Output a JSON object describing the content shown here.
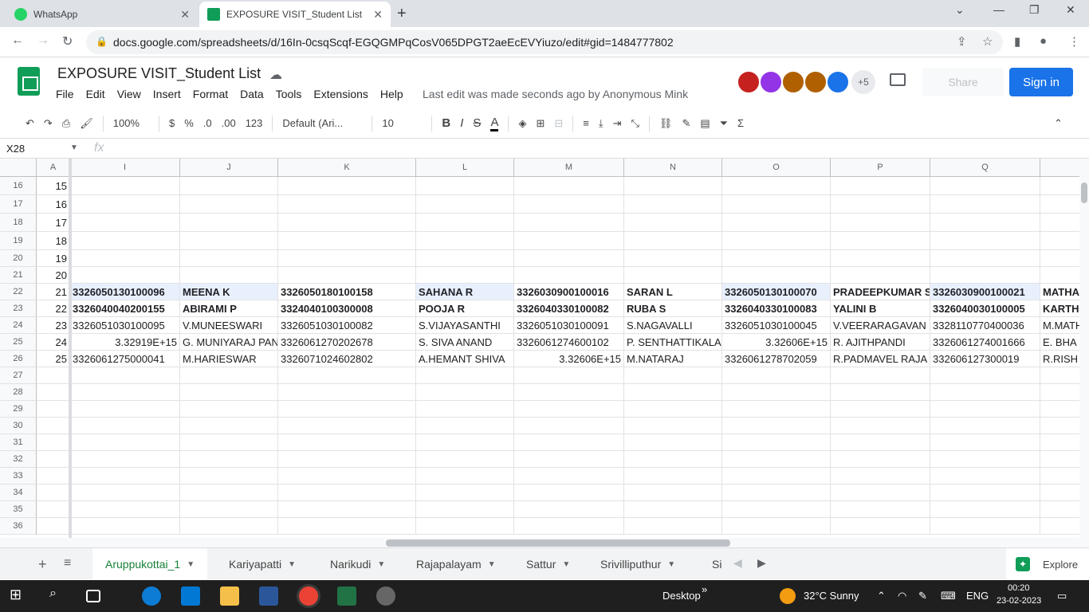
{
  "browser": {
    "tabs": [
      {
        "title": "WhatsApp",
        "favicon": "whatsapp-icon",
        "color": "#25d366"
      },
      {
        "title": "EXPOSURE VISIT_Student List - G",
        "favicon": "sheets-icon",
        "color": "#0f9d58"
      }
    ],
    "url": "docs.google.com/spreadsheets/d/16In-0csqScqf-EGQGMPqCosV065DPGT2aeEcEVYiuzo/edit#gid=1484777802"
  },
  "doc": {
    "title": "EXPOSURE VISIT_Student List",
    "menu": [
      "File",
      "Edit",
      "View",
      "Insert",
      "Format",
      "Data",
      "Tools",
      "Extensions",
      "Help"
    ],
    "last_edit": "Last edit was made seconds ago by Anonymous Mink",
    "more_collaborators": "+5",
    "share_label": "Share",
    "signin_label": "Sign in",
    "collaborator_colors": [
      "#c5221f",
      "#9334e6",
      "#b06000",
      "#b06000",
      "#1a73e8"
    ]
  },
  "toolbar": {
    "zoom": "100%",
    "currency": "$",
    "percent": "%",
    "decrease_decimal": ".0",
    "increase_decimal": ".00",
    "number_format": "123",
    "font": "Default (Ari...",
    "font_size": "10",
    "bold": "B",
    "italic": "I",
    "strike": "S",
    "text_color": "A"
  },
  "formula": {
    "name_box": "X28",
    "fx": "fx"
  },
  "grid": {
    "columns": [
      "A",
      "I",
      "J",
      "K",
      "L",
      "M",
      "N",
      "O",
      "P",
      "Q",
      ""
    ],
    "row_numbers": [
      "16",
      "17",
      "18",
      "19",
      "20",
      "21",
      "22",
      "23",
      "24",
      "25",
      "26",
      "27",
      "28",
      "29",
      "30",
      "31",
      "32",
      "33",
      "34",
      "35",
      "36"
    ],
    "rows": [
      [
        "15",
        "",
        "",
        "",
        "",
        "",
        "",
        "",
        "",
        "",
        ""
      ],
      [
        "16",
        "",
        "",
        "",
        "",
        "",
        "",
        "",
        "",
        "",
        ""
      ],
      [
        "17",
        "",
        "",
        "",
        "",
        "",
        "",
        "",
        "",
        "",
        ""
      ],
      [
        "18",
        "",
        "",
        "",
        "",
        "",
        "",
        "",
        "",
        "",
        ""
      ],
      [
        "19",
        "",
        "",
        "",
        "",
        "",
        "",
        "",
        "",
        "",
        ""
      ],
      [
        "20",
        "",
        "",
        "",
        "",
        "",
        "",
        "",
        "",
        "",
        ""
      ],
      [
        "21",
        "3326050130100096",
        "MEENA K",
        "3326050180100158",
        "SAHANA R",
        "3326030900100016",
        "SARAN L",
        "3326050130100070",
        "PRADEEPKUMAR S",
        "3326030900100021",
        "MATHA"
      ],
      [
        "22",
        "3326040040200155",
        "ABIRAMI P",
        "3324040100300008",
        "POOJA R",
        "3326040330100082",
        "RUBA S",
        "3326040330100083",
        "YALINI B",
        "3326040030100005",
        "KARTH"
      ],
      [
        "23",
        "3326051030100095",
        "V.MUNEESWARI",
        "3326051030100082",
        "S.VIJAYASANTHI",
        "3326051030100091",
        "S.NAGAVALLI",
        "3326051030100045",
        "V.VEERARAGAVAN",
        "3328110770400036",
        "M.MATH"
      ],
      [
        "24",
        "3.32919E+15",
        "G. MUNIYARAJ PAN",
        "3326061270202678",
        "S. SIVA ANAND",
        "3326061274600102",
        "P. SENTHATTIKALA",
        "3.32606E+15",
        "R. AJITHPANDI",
        "3326061274001666",
        "E. BHA"
      ],
      [
        "25",
        "3326061275000041",
        "M.HARIESWAR",
        "3326071024602802",
        "A.HEMANT SHIVA",
        "3.32606E+15",
        "M.NATARAJ",
        "3326061278702059",
        "R.PADMAVEL RAJA",
        "332606127300019",
        "R.RISH"
      ],
      [
        "",
        "",
        "",
        "",
        "",
        "",
        "",
        "",
        "",
        "",
        ""
      ],
      [
        "",
        "",
        "",
        "",
        "",
        "",
        "",
        "",
        "",
        "",
        ""
      ],
      [
        "",
        "",
        "",
        "",
        "",
        "",
        "",
        "",
        "",
        "",
        ""
      ],
      [
        "",
        "",
        "",
        "",
        "",
        "",
        "",
        "",
        "",
        "",
        ""
      ],
      [
        "",
        "",
        "",
        "",
        "",
        "",
        "",
        "",
        "",
        "",
        ""
      ],
      [
        "",
        "",
        "",
        "",
        "",
        "",
        "",
        "",
        "",
        "",
        ""
      ],
      [
        "",
        "",
        "",
        "",
        "",
        "",
        "",
        "",
        "",
        "",
        ""
      ],
      [
        "",
        "",
        "",
        "",
        "",
        "",
        "",
        "",
        "",
        "",
        ""
      ],
      [
        "",
        "",
        "",
        "",
        "",
        "",
        "",
        "",
        "",
        "",
        ""
      ],
      [
        "",
        "",
        "",
        "",
        "",
        "",
        "",
        "",
        "",
        "",
        ""
      ]
    ]
  },
  "sheets": [
    "Aruppukottai_1",
    "Kariyapatti",
    "Narikudi",
    "Rajapalayam",
    "Sattur",
    "Srivilliputhur",
    "Si"
  ],
  "explore_label": "Explore",
  "taskbar": {
    "desktop_label": "Desktop",
    "weather": "32°C  Sunny",
    "lang": "ENG",
    "time": "00:20",
    "date": "23-02-2023"
  }
}
